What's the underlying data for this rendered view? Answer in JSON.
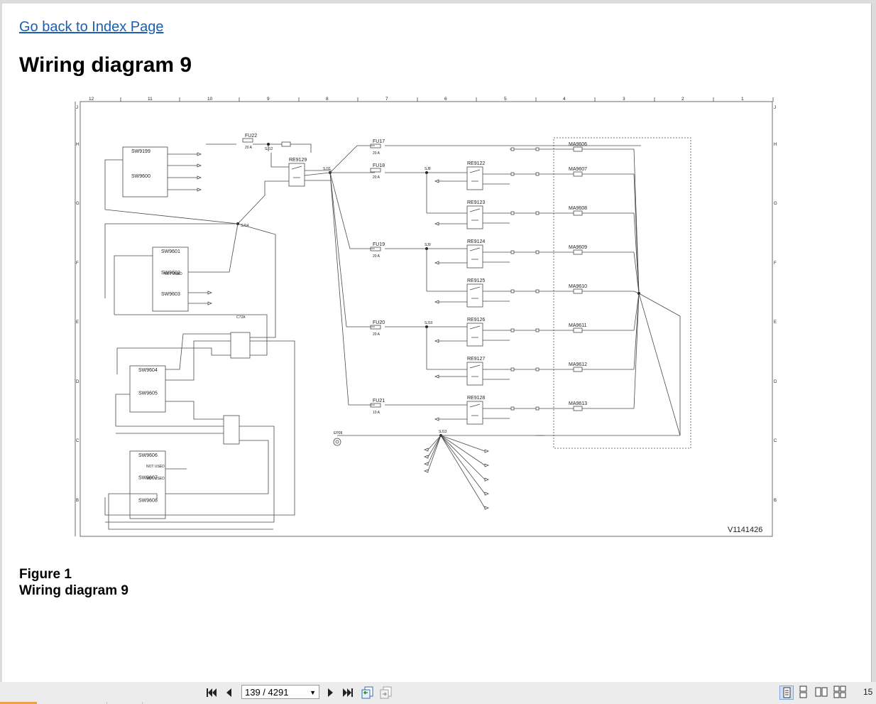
{
  "page": {
    "back_link": "Go back to Index Page",
    "title": "Wiring diagram 9",
    "caption": {
      "figure": "Figure 1",
      "text": "Wiring diagram 9"
    }
  },
  "diagram": {
    "id": "V1141426",
    "columns": [
      "12",
      "11",
      "10",
      "9",
      "8",
      "7",
      "6",
      "5",
      "4",
      "3",
      "2",
      "1"
    ],
    "rows": [
      "J",
      "H",
      "G",
      "F",
      "E",
      "D",
      "C",
      "B"
    ],
    "switches": [
      "SW9199",
      "SW9600",
      "SW9601",
      "SW9602",
      "SW9603",
      "SW9604",
      "SW9605",
      "SW9606",
      "SW9607",
      "SW9608"
    ],
    "fuses": [
      {
        "name": "FU22",
        "rating": "20 A"
      },
      {
        "name": "FU17",
        "rating": "20 A"
      },
      {
        "name": "FU18",
        "rating": "20 A"
      },
      {
        "name": "FU19",
        "rating": "20 A"
      },
      {
        "name": "FU20",
        "rating": "20 A"
      },
      {
        "name": "FU21",
        "rating": "10 A"
      }
    ],
    "relays": [
      "RE9129",
      "RE9122",
      "RE9123",
      "RE9124",
      "RE9125",
      "RE9126",
      "RE9127",
      "RE9128"
    ],
    "actuators": [
      "MA9606",
      "MA9607",
      "MA9608",
      "MA9609",
      "MA9610",
      "MA9611",
      "MA9612",
      "MA9613"
    ],
    "splices": [
      "SJ12",
      "SJ14",
      "SJ11",
      "SJ8",
      "SJ9",
      "SJ10",
      "SJ13"
    ],
    "connectors": [
      "C72A",
      "EP08"
    ],
    "not_used_label": "NOT USED"
  },
  "toolbar": {
    "page_indicator": "139 / 4291",
    "zoom": "15",
    "icons": [
      "first-page-icon",
      "prev-page-icon",
      "next-page-icon",
      "last-page-icon",
      "go-back-view-icon",
      "go-forward-view-icon",
      "single-page-view-icon",
      "continuous-view-icon",
      "facing-view-icon",
      "continuous-facing-view-icon"
    ]
  },
  "colors": {
    "link": "#1a5fb4",
    "toolbar_bg": "#ececec",
    "progress": "#f0a040",
    "diagram_line": "#4a4a4a"
  }
}
